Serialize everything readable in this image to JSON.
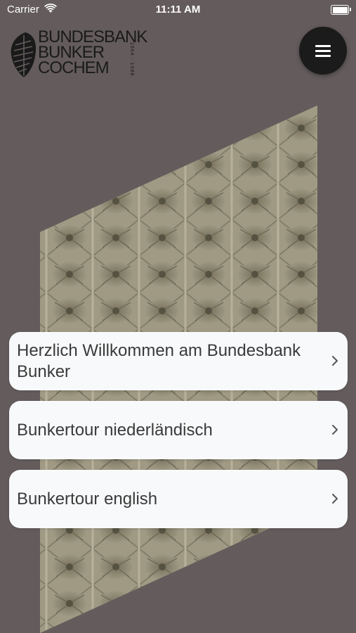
{
  "status_bar": {
    "carrier": "Carrier",
    "time": "11:11 AM"
  },
  "logo": {
    "line1": "BUNDESBANK",
    "line2": "BUNKER",
    "line3": "COCHEM",
    "years": "1964 - 1988"
  },
  "menu": {
    "icon": "hamburger-menu-icon"
  },
  "cards": [
    {
      "label": "Herzlich Willkommen am Bundesbank Bunker",
      "icon": "chevron-right-icon"
    },
    {
      "label": "Bunkertour niederländisch",
      "icon": "chevron-right-icon"
    },
    {
      "label": "Bunkertour english",
      "icon": "chevron-right-icon"
    }
  ],
  "colors": {
    "background": "#645c5c",
    "card": "#f8f9fb",
    "menu_button": "#1c1b1b"
  }
}
